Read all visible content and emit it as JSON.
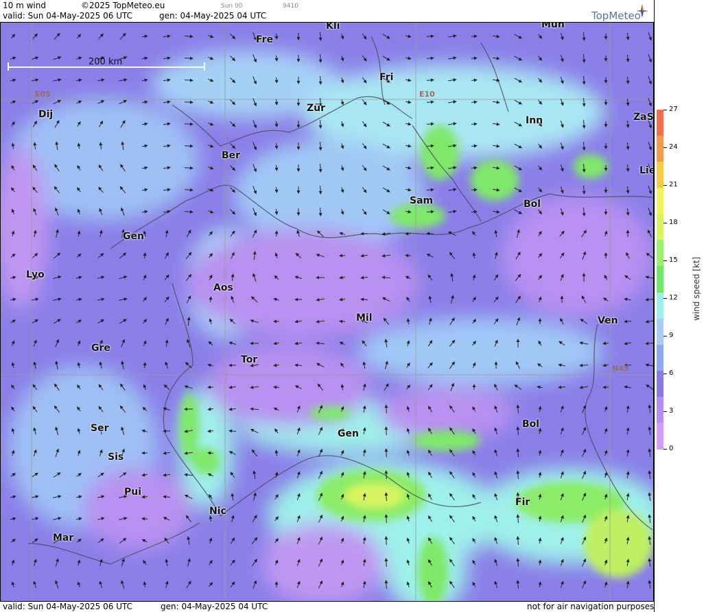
{
  "header": {
    "product": "10 m wind",
    "copyright": "©2025 TopMeteo.eu",
    "run_label": "Sun 00",
    "code": "9410",
    "valid": "valid:  Sun  04-May-2025  06 UTC",
    "gen": "gen: 04-May-2025 04 UTC",
    "brand": "TopMeteo"
  },
  "footer": {
    "valid": "valid:  Sun  04-May-2025  06 UTC",
    "gen": "gen: 04-May-2025 04 UTC",
    "disclaimer": "not for air navigation purposes"
  },
  "map": {
    "scale_label": "200 km",
    "grid_labels": {
      "lon1": "E05",
      "lon2": "E10",
      "lat": "N45"
    },
    "cities": [
      {
        "name": "Kli"
      },
      {
        "name": "Mün"
      },
      {
        "name": "Fre"
      },
      {
        "name": "Fri"
      },
      {
        "name": "Dij"
      },
      {
        "name": "Zür"
      },
      {
        "name": "Inn"
      },
      {
        "name": "ZaS"
      },
      {
        "name": "Ber"
      },
      {
        "name": "Lie"
      },
      {
        "name": "Sam"
      },
      {
        "name": "Bol"
      },
      {
        "name": "Gen"
      },
      {
        "name": "Lyo"
      },
      {
        "name": "Aos"
      },
      {
        "name": "Mil"
      },
      {
        "name": "Ven"
      },
      {
        "name": "Gre"
      },
      {
        "name": "Tor"
      },
      {
        "name": "Ser"
      },
      {
        "name": "Gen"
      },
      {
        "name": "Bol"
      },
      {
        "name": "Sis"
      },
      {
        "name": "Pui"
      },
      {
        "name": "Fir"
      },
      {
        "name": "Nic"
      },
      {
        "name": "Mar"
      }
    ]
  },
  "legend": {
    "title": "wind speed [kt]",
    "ticks": [
      "27",
      "24",
      "21",
      "18",
      "15",
      "12",
      "9",
      "6",
      "3",
      "0"
    ],
    "colors": [
      "#f07050",
      "#f39b4a",
      "#f5cc45",
      "#f2f25a",
      "#d8f560",
      "#9af26a",
      "#6fe86a",
      "#9ef0ea",
      "#a9cdf5",
      "#8fa8f2",
      "#8a79e8",
      "#b78ef0",
      "#d59bf5"
    ]
  }
}
